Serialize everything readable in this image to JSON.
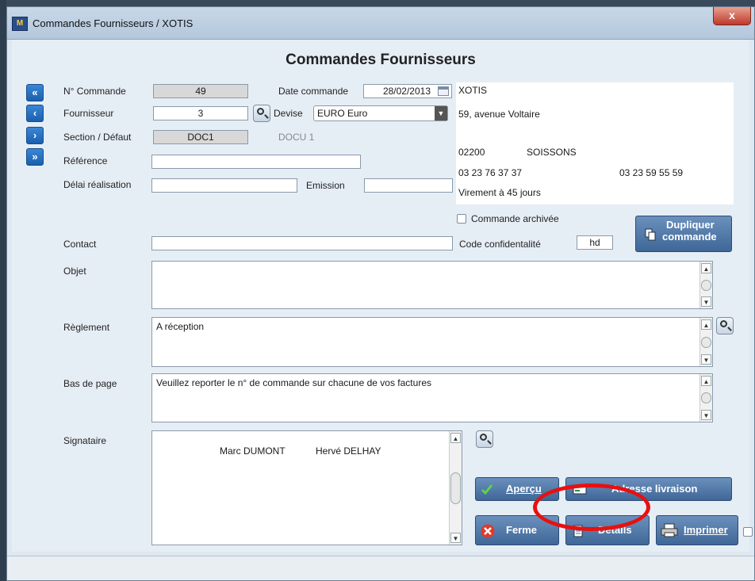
{
  "window": {
    "title": "Commandes Fournisseurs   / XOTIS",
    "close_label": "x",
    "app_icon": "app-icon"
  },
  "heading": "Commandes Fournisseurs",
  "nav": [
    "«",
    "‹",
    "›",
    "»"
  ],
  "fields": {
    "numero_label": "N° Commande",
    "numero_value": "49",
    "date_label": "Date commande",
    "date_value": "28/02/2013",
    "fournisseur_label": "Fournisseur",
    "fournisseur_value": "3",
    "devise_label": "Devise",
    "devise_value": "EURO  Euro",
    "section_label": "Section / Défaut",
    "section_value": "DOC1",
    "section_desc": "DOCU 1",
    "reference_label": "Référence",
    "reference_value": "",
    "delai_label": "Délai réalisation",
    "delai_value": "",
    "emission_label": "Emission",
    "emission_value": "",
    "contact_label": "Contact",
    "contact_value": "",
    "confid_label": "Code confidentalité",
    "confid_value": "hd",
    "objet_label": "Objet",
    "objet_value": "",
    "reglement_label": "Règlement",
    "reglement_value": "A réception",
    "bas_label": "Bas de page",
    "bas_value": "Veuillez reporter le n° de commande sur chacune de vos factures",
    "signataire_label": "Signataire",
    "signataire_1": "Marc DUMONT",
    "signataire_2": "Hervé DELHAY"
  },
  "address": {
    "name": "XOTIS",
    "street": "59, avenue Voltaire",
    "zip": "02200",
    "city": "SOISSONS",
    "phone": "03 23 76 37 37",
    "fax": "03 23 59 55 59",
    "payment": "Virement à 45 jours"
  },
  "archive_label": "Commande archivée",
  "buttons": {
    "dupliquer_1": "Dupliquer",
    "dupliquer_2": "commande",
    "apercu": "Aperçu",
    "adresse": "Adresse livraison",
    "fermer": "Ferme",
    "details": "Détails",
    "imprimer": "Imprimer"
  },
  "colors": {
    "accent": "#1b5fae",
    "button": "#4f77a6",
    "highlight": "#e8100f"
  }
}
